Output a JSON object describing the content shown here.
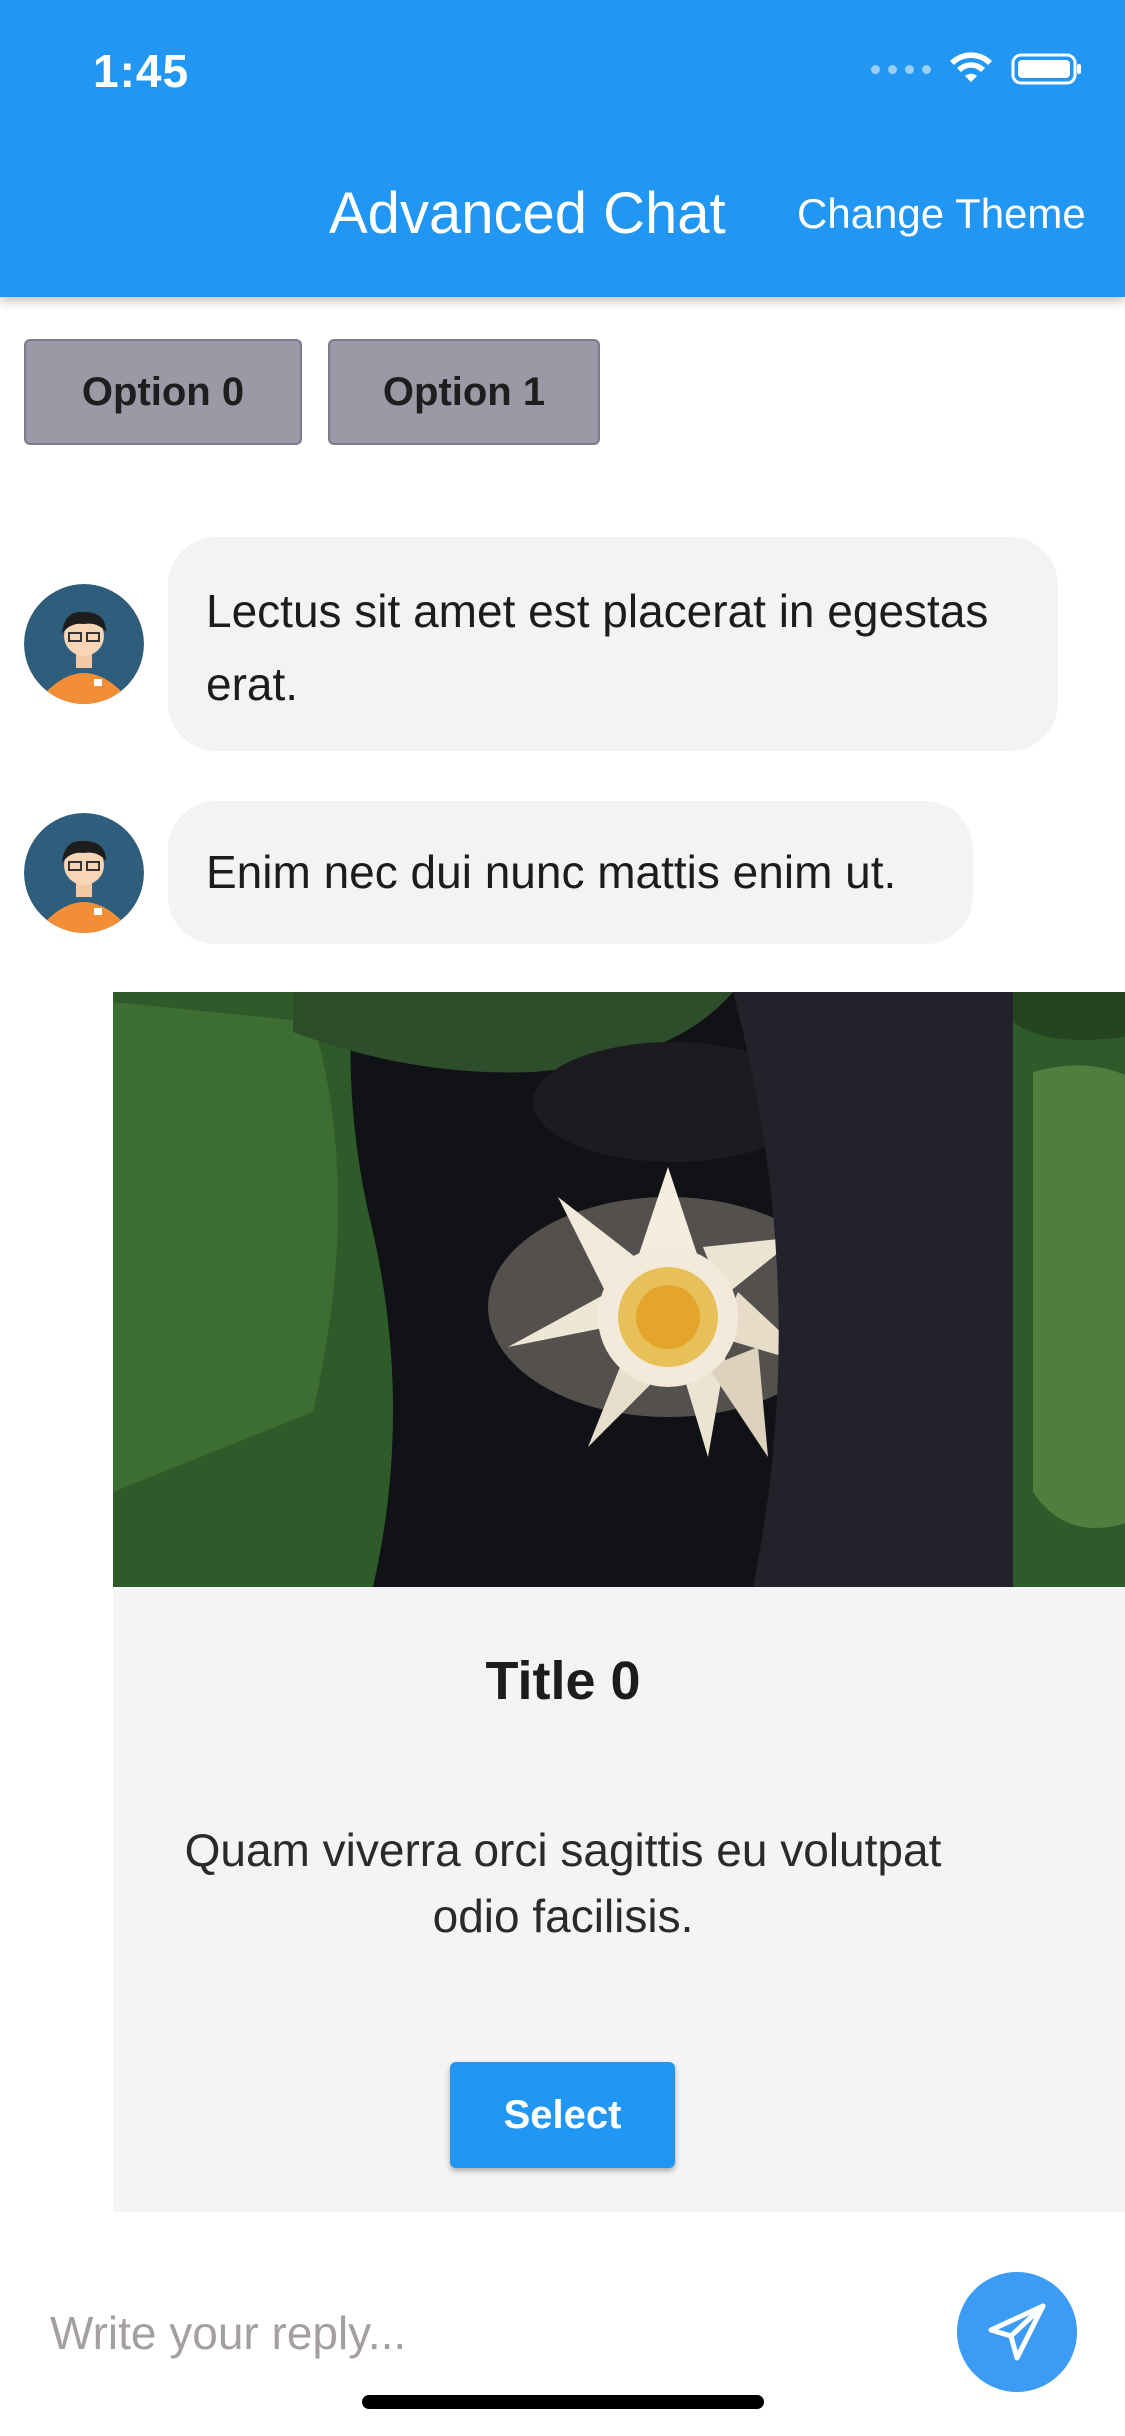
{
  "status_bar": {
    "time": "1:45"
  },
  "header": {
    "title": "Advanced Chat",
    "theme_button": "Change Theme"
  },
  "options": [
    "Option 0",
    "Option 1"
  ],
  "messages": [
    {
      "text": "Lectus sit amet est placerat in egestas erat."
    },
    {
      "text": "Enim nec dui nunc mattis enim ut."
    }
  ],
  "card": {
    "title": "Title 0",
    "description": "Quam viverra orci sagittis eu volutpat odio facilisis.",
    "button": "Select"
  },
  "composer": {
    "placeholder": "Write your reply..."
  },
  "colors": {
    "primary": "#2196f3",
    "bubble": "#f3f3f6",
    "option_button": "#9b99a6"
  },
  "icons": {
    "send": "send-icon",
    "wifi": "wifi-icon",
    "battery": "battery-icon"
  }
}
